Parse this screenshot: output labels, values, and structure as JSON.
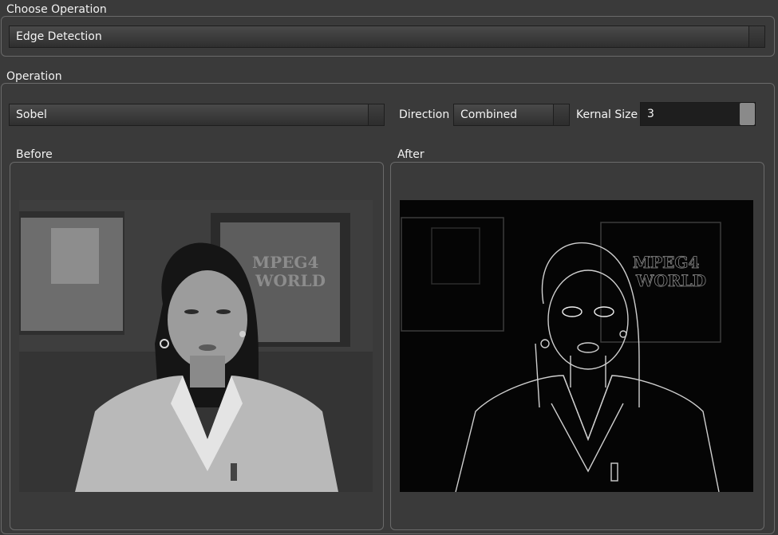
{
  "choose_operation": {
    "title": "Choose Operation",
    "selected": "Edge Detection"
  },
  "operation": {
    "title": "Operation",
    "method_selected": "Sobel",
    "direction_label": "Direction",
    "direction_selected": "Combined",
    "kernel_label": "Kernal Size",
    "kernel_value": "3"
  },
  "before": {
    "title": "Before",
    "image_icon": "news-anchor-photo"
  },
  "after": {
    "title": "After",
    "image_icon": "edge-detected-photo"
  },
  "colors": {
    "background": "#3a3a3a",
    "border": "#6a6a6a",
    "text": "#f4f4f4"
  }
}
